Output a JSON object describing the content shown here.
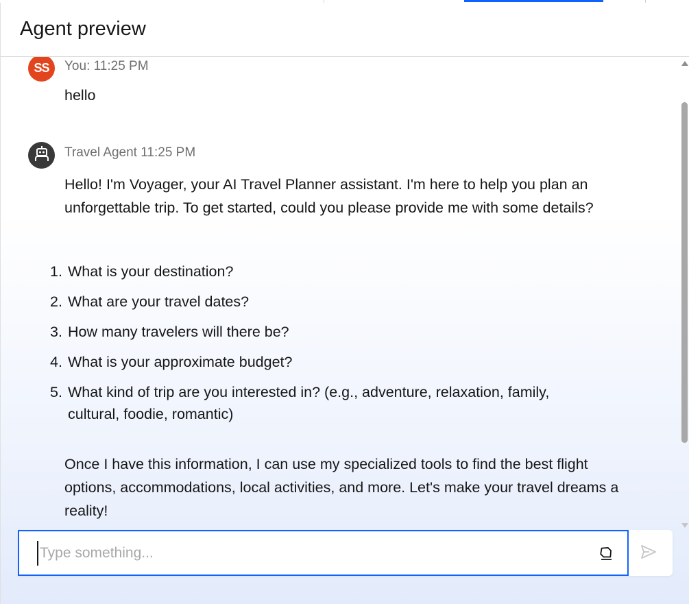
{
  "panel": {
    "title": "Agent preview"
  },
  "messages": [
    {
      "sender": "user",
      "avatar_initials": "SS",
      "meta": "You: 11:25 PM",
      "text": "hello"
    },
    {
      "sender": "agent",
      "avatar_icon": "robot-icon",
      "meta": "Travel Agent 11:25 PM",
      "intro": "Hello! I'm Voyager, your AI Travel Planner assistant. I'm here to help you plan an unforgettable trip. To get started, could you please provide me with some details?",
      "questions": [
        {
          "num": "1.",
          "text": "What is your destination?"
        },
        {
          "num": "2.",
          "text": "What are your travel dates?"
        },
        {
          "num": "3.",
          "text": "How many travelers will there be?"
        },
        {
          "num": "4.",
          "text": "What is your approximate budget?"
        },
        {
          "num": "5.",
          "text": "What kind of trip are you interested in? (e.g., adventure, relaxation, family, cultural, foodie, romantic)"
        }
      ],
      "outro": "Once I have this information, I can use my specialized tools to find the best flight options, accommodations, local activities, and more. Let's make your travel dreams a reality!"
    }
  ],
  "input": {
    "placeholder": "Type something...",
    "value": ""
  },
  "icons": {
    "clear": "eraser-icon",
    "send": "send-icon"
  },
  "colors": {
    "accent": "#0f62fe",
    "user_avatar": "#e2451e",
    "bot_avatar": "#393939"
  }
}
